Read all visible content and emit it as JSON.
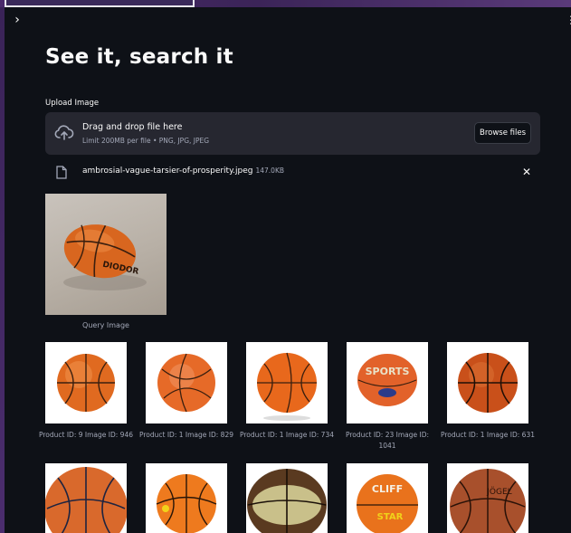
{
  "header": {
    "expand_icon": "chevron-right-icon",
    "menu_icon": "kebab-icon"
  },
  "page": {
    "title": "See it, search it"
  },
  "uploader": {
    "label": "Upload Image",
    "drop_title": "Drag and drop file here",
    "limit_text": "Limit 200MB per file • PNG, JPG, JPEG",
    "browse_label": "Browse files",
    "icon": "cloud-upload-icon"
  },
  "file": {
    "name": "ambrosial-vague-tarsier-of-prosperity.jpeg",
    "size": "147.0KB",
    "icon": "file-icon",
    "close_icon": "close-icon"
  },
  "query": {
    "caption": "Query Image"
  },
  "results": [
    {
      "caption": "Product ID: 9 Image ID: 946"
    },
    {
      "caption": "Product ID: 1 Image ID: 829"
    },
    {
      "caption": "Product ID: 1 Image ID: 734"
    },
    {
      "caption": "Product ID: 23 Image ID: 1041"
    },
    {
      "caption": "Product ID: 1 Image ID: 631"
    }
  ],
  "colors": {
    "background": "#0e1117",
    "panel": "#262730",
    "text": "#fafafa",
    "muted": "#a3a8b8",
    "accent_ball": "#e0681f"
  }
}
